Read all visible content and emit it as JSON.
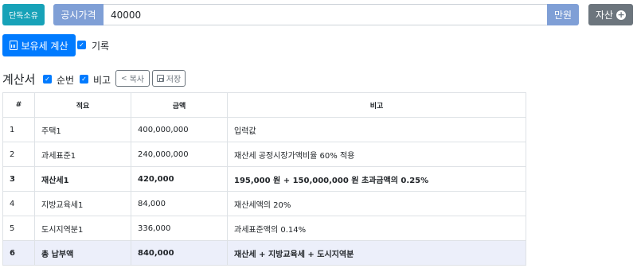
{
  "topbar": {
    "owner_button": "단독소유",
    "price_label": "공시가격",
    "price_value": "40000",
    "unit": "만원",
    "asset_button": "자산"
  },
  "actions": {
    "calc_button": "보유세 계산",
    "record_label": "기록"
  },
  "sheet": {
    "title": "계산서",
    "order_label": "순번",
    "note_label": "비고",
    "copy_button": "복사",
    "save_button": "저장"
  },
  "table": {
    "headers": [
      "#",
      "적요",
      "금액",
      "비고"
    ],
    "rows": [
      {
        "no": "1",
        "item": "주택1",
        "amount": "400,000,000",
        "note": "입력값"
      },
      {
        "no": "2",
        "item": "과세표준1",
        "amount": "240,000,000",
        "note": "재산세 공정시장가액비율 60% 적용"
      },
      {
        "no": "3",
        "item": "재산세1",
        "amount": "420,000",
        "note": "195,000 원 + 150,000,000 원 초과금액의 0.25%"
      },
      {
        "no": "4",
        "item": "지방교육세1",
        "amount": "84,000",
        "note": "재산세액의 20%"
      },
      {
        "no": "5",
        "item": "도시지역분1",
        "amount": "336,000",
        "note": "과세표준액의 0.14%"
      },
      {
        "no": "6",
        "item": "총 납부액",
        "amount": "840,000",
        "note": "재산세 + 지방교육세 + 도시지역분"
      }
    ]
  },
  "colors": {
    "info": "#17a2b8",
    "primary": "#007bff",
    "input_addon": "#7f9fd6",
    "secondary": "#6c757d",
    "total_row_bg": "#eceffa"
  }
}
